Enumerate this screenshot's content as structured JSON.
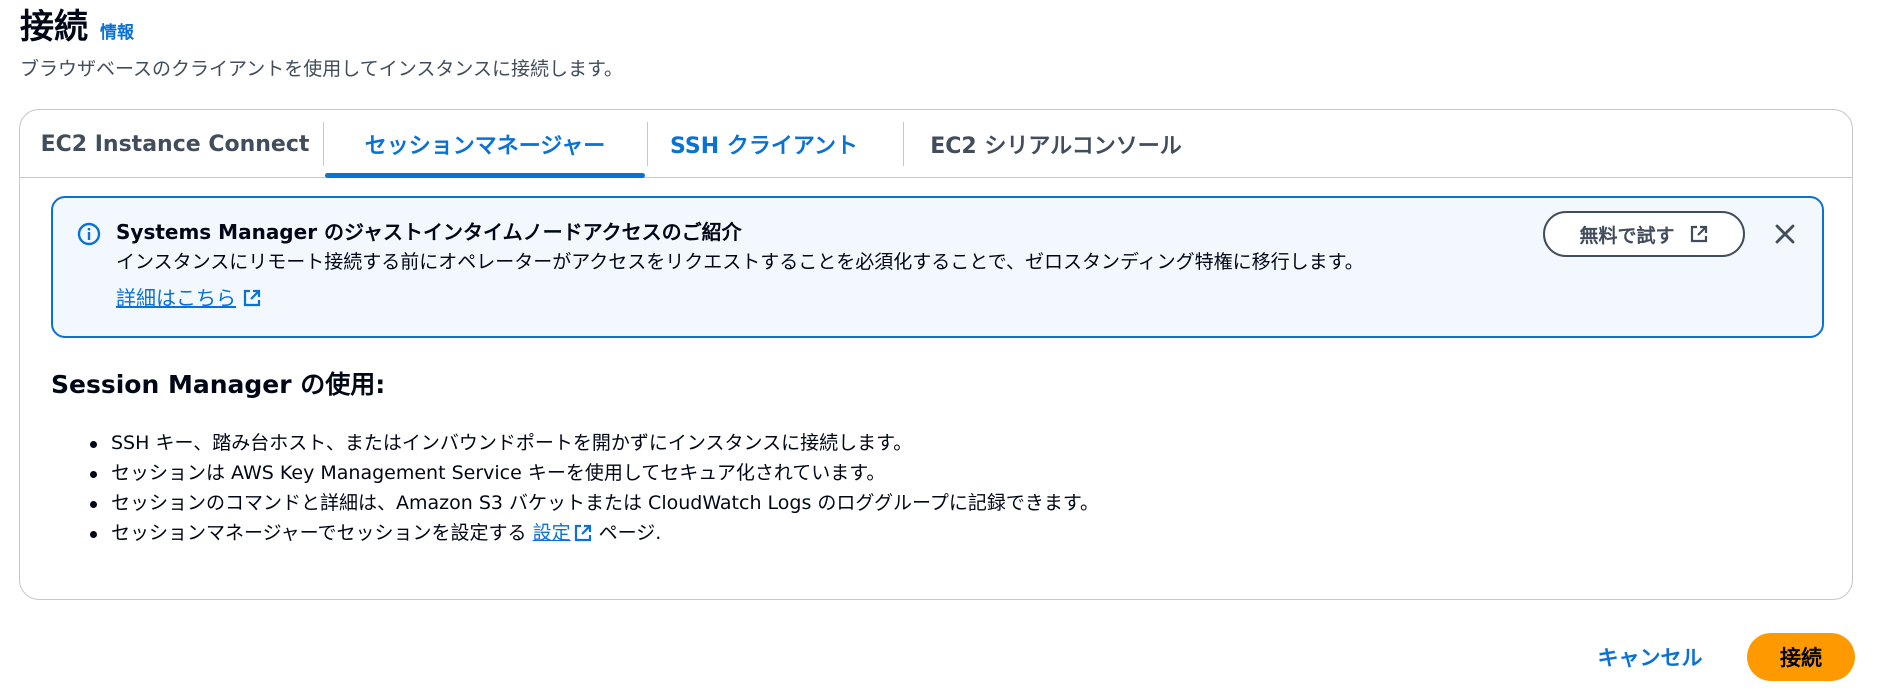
{
  "header": {
    "title": "接続",
    "info_label": "情報",
    "description": "ブラウザベースのクライアントを使用してインスタンスに接続します。"
  },
  "tabs": [
    {
      "label": "EC2 Instance Connect",
      "state": "default"
    },
    {
      "label": "セッションマネージャー",
      "state": "active"
    },
    {
      "label": "SSH クライアント",
      "state": "link"
    },
    {
      "label": "EC2 シリアルコンソール",
      "state": "default"
    }
  ],
  "alert": {
    "icon": "info-circle-icon",
    "title": "Systems Manager のジャストインタイムノードアクセスのご紹介",
    "body": "インスタンスにリモート接続する前にオペレーターがアクセスをリクエストすることを必須化することで、ゼロスタンディング特権に移行します。",
    "link_label": "詳細はこちら",
    "try_button_label": "無料で試す",
    "close_icon": "close-icon"
  },
  "session": {
    "heading": "Session Manager の使用:",
    "bullets": [
      "SSH キー、踏み台ホスト、またはインバウンドポートを開かずにインスタンスに接続します。",
      "セッションは AWS Key Management Service キーを使用してセキュア化されています。",
      "セッションのコマンドと詳細は、Amazon S3 バケットまたは CloudWatch Logs のロググループに記録できます。"
    ],
    "last_bullet": {
      "prefix": "セッションマネージャーでセッションを設定する ",
      "link_label": "設定",
      "suffix": " ページ."
    }
  },
  "footer": {
    "cancel_label": "キャンセル",
    "connect_label": "接続"
  },
  "colors": {
    "accent": "#0972d3",
    "primary_button": "#ff9900",
    "alert_background": "#f2f8fd",
    "text": "#000716"
  }
}
